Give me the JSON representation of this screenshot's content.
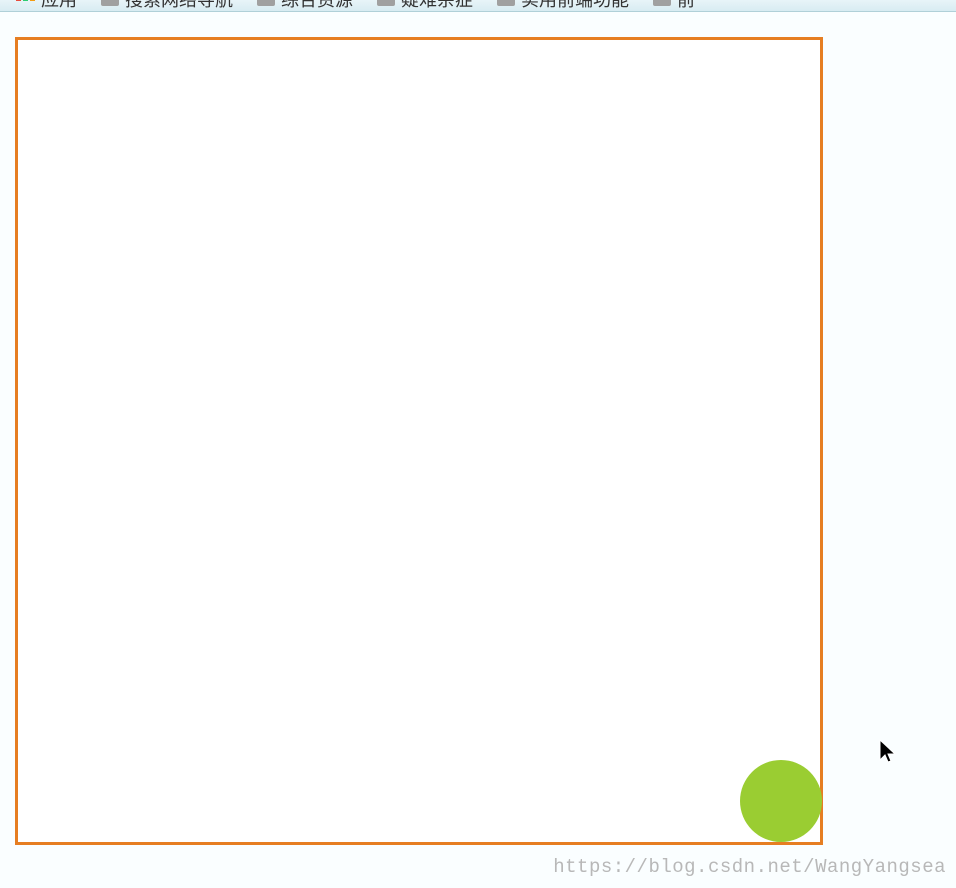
{
  "bookmarks": {
    "items": [
      {
        "label": "应用",
        "type": "app"
      },
      {
        "label": "搜索网络导航",
        "type": "folder"
      },
      {
        "label": "综合资源",
        "type": "folder"
      },
      {
        "label": "疑难杂症",
        "type": "folder"
      },
      {
        "label": "实用前端功能",
        "type": "folder"
      },
      {
        "label": "前",
        "type": "folder"
      }
    ]
  },
  "canvas": {
    "border_color": "#e67e22",
    "ball_color": "#9acd32"
  },
  "watermark": {
    "text": "https://blog.csdn.net/WangYangsea"
  }
}
